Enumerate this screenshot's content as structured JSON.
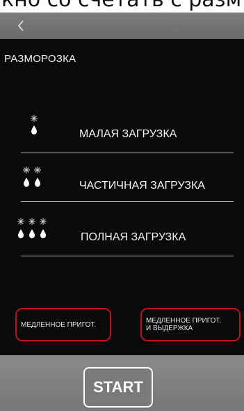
{
  "caption": {
    "text": "кно со счетать с разм"
  },
  "topbar": {
    "back_icon": "chevron-left-icon"
  },
  "screen": {
    "title": "РАЗМОРОЗКА"
  },
  "options": [
    {
      "label": "МАЛАЯ ЗАГРУЗКА",
      "icon": "snowflake-drop-icon",
      "count": 1
    },
    {
      "label": "ЧАСТИЧНАЯ ЗАГРУЗКА",
      "icon": "snowflake-drop-icon",
      "count": 2
    },
    {
      "label": "ПОЛНАЯ ЗАГРУЗКА",
      "icon": "snowflake-drop-icon",
      "count": 3
    }
  ],
  "modes": {
    "slow_cook": "МЕДЛЕННОЕ ПРИГОТ.",
    "slow_cook_hold_line1": "МЕДЛЕННОЕ ПРИГОТ.",
    "slow_cook_hold_line2": "И ВЫДЕРЖКА"
  },
  "start": {
    "label": "START"
  },
  "colors": {
    "background": "#0a0a0a",
    "bar": "#777777",
    "highlight": "#c0101c",
    "text": "#f2f2f2"
  }
}
